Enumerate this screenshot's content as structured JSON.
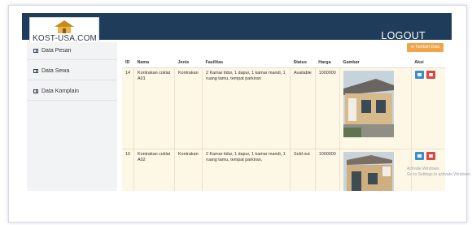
{
  "header": {
    "logo_text": "KOST-USA.COM",
    "logout_label": "LOGOUT"
  },
  "sidebar": {
    "items": [
      {
        "label": "Data Pesan",
        "icon": "table-icon"
      },
      {
        "label": "Data Sewa",
        "icon": "table-icon"
      },
      {
        "label": "Data Komplain",
        "icon": "table-icon"
      }
    ]
  },
  "toolbar": {
    "add_label": "Tambah Data"
  },
  "table": {
    "columns": [
      "ID",
      "Nama",
      "Jenis",
      "Fasilitas",
      "Status",
      "Harga",
      "Gambar",
      "Aksi"
    ],
    "rows": [
      {
        "id": "14",
        "nama": "Kontrakan coklat A01",
        "jenis": "Kontrakan",
        "fasilitas": "2 Kamar tidur, 1 dapur, 1 kamar mandi, 1 ruang tamu, tempat parkiran",
        "status": "Available",
        "harga": "1000000"
      },
      {
        "id": "16",
        "nama": "Kontrakan coklat A02",
        "jenis": "Kontrakan",
        "fasilitas": "2 Kamar tidur, 1 dapur, 1 kamar mandi, 1 ruang tamu, tempat parkiran,",
        "status": "Sold out",
        "harga": "1000000"
      }
    ]
  },
  "watermark": {
    "line1": "Activate Windows",
    "line2": "Go to Settings to activate Windows."
  },
  "colors": {
    "topbar": "#1f3c5a",
    "add_button": "#f0a54a",
    "edit_button": "#3c8dcf",
    "delete_button": "#d94646",
    "row_bg": "#fdf7e5"
  }
}
